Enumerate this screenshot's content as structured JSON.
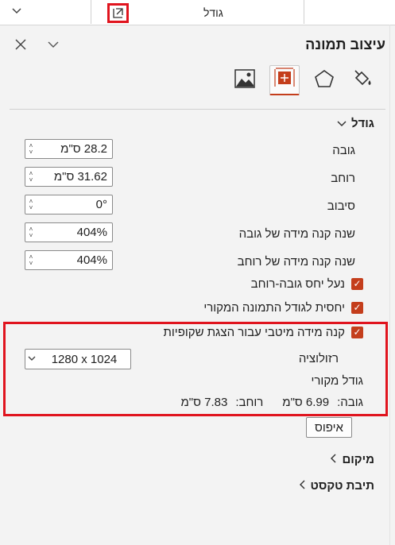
{
  "ribbon": {
    "group_label": "גודל",
    "launcher_icon": "dialog-launcher-icon",
    "collapse_icon": "chevron-down-icon"
  },
  "pane": {
    "title": "עיצוב תמונה",
    "options_icon": "chevron-down-icon",
    "close_icon": "close-icon",
    "tabs": [
      {
        "name": "fill-line",
        "icon": "paint-bucket-icon"
      },
      {
        "name": "effects",
        "icon": "pentagon-icon"
      },
      {
        "name": "size-properties",
        "icon": "size-properties-icon",
        "active": true
      },
      {
        "name": "picture",
        "icon": "picture-icon"
      }
    ]
  },
  "size_section": {
    "title": "גודל",
    "height_label": "גובה",
    "height_value": "28.2 ס\"מ",
    "width_label": "רוחב",
    "width_value": "31.62 ס\"מ",
    "rotation_label": "סיבוב",
    "rotation_value": "0°",
    "scale_height_label": "שנה קנה מידה של גובה",
    "scale_height_value": "404%",
    "scale_width_label": "שנה קנה מידה של רוחב",
    "scale_width_value": "404%",
    "lock_aspect_label": "נעל יחס גובה-רוחב",
    "relative_original_label": "יחסית לגודל התמונה המקורי",
    "best_scale_label": "קנה מידה מיטבי עבור הצגת שקופיות",
    "resolution_label": "רזולוציה",
    "resolution_value": "1280 x 1024",
    "original_size_label": "גודל מקורי",
    "orig_height_label": "גובה:",
    "orig_height_value": "6.99 ס\"מ",
    "orig_width_label": "רוחב:",
    "orig_width_value": "7.83 ס\"מ",
    "reset_label": "איפוס"
  },
  "sections": {
    "position": "מיקום",
    "text_box": "תיבת טקסט"
  },
  "colors": {
    "accent": "#c43e1c",
    "highlight": "#e0141e"
  }
}
